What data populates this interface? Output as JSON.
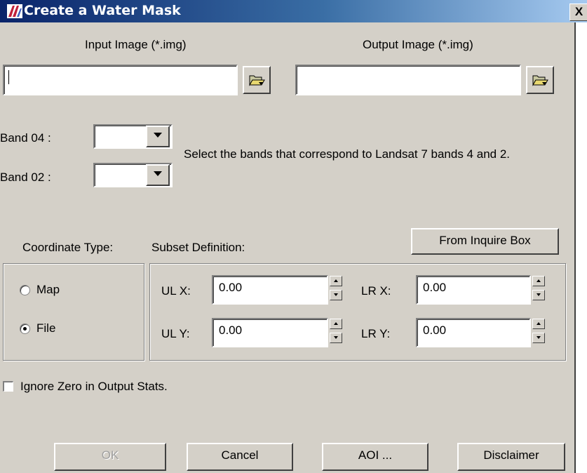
{
  "window": {
    "title": "Create a Water Mask",
    "close_glyph": "X"
  },
  "input_image": {
    "label": "Input Image (*.img)",
    "value": ""
  },
  "output_image": {
    "label": "Output Image (*.img)",
    "value": ""
  },
  "band04": {
    "label": "Band 04 :",
    "value": ""
  },
  "band02": {
    "label": "Band 02 :",
    "value": ""
  },
  "band_hint": "Select the bands that correspond to Landsat 7 bands 4 and 2.",
  "coordinate_type": {
    "label": "Coordinate Type:",
    "options": [
      "Map",
      "File"
    ],
    "selected": "File"
  },
  "subset": {
    "label": "Subset Definition:",
    "from_inquire_label": "From Inquire Box",
    "ulx": {
      "label": "UL X:",
      "value": "0.00"
    },
    "uly": {
      "label": "UL Y:",
      "value": "0.00"
    },
    "lrx": {
      "label": "LR X:",
      "value": "0.00"
    },
    "lry": {
      "label": "LR Y:",
      "value": "0.00"
    }
  },
  "ignore_zero": {
    "label": "Ignore Zero in Output Stats.",
    "checked": false
  },
  "buttons": {
    "ok": "OK",
    "cancel": "Cancel",
    "aoi": "AOI ...",
    "disclaimer": "Disclaimer"
  },
  "icons": {
    "browse": "folder-open-icon",
    "app": "imagine-app-icon"
  }
}
